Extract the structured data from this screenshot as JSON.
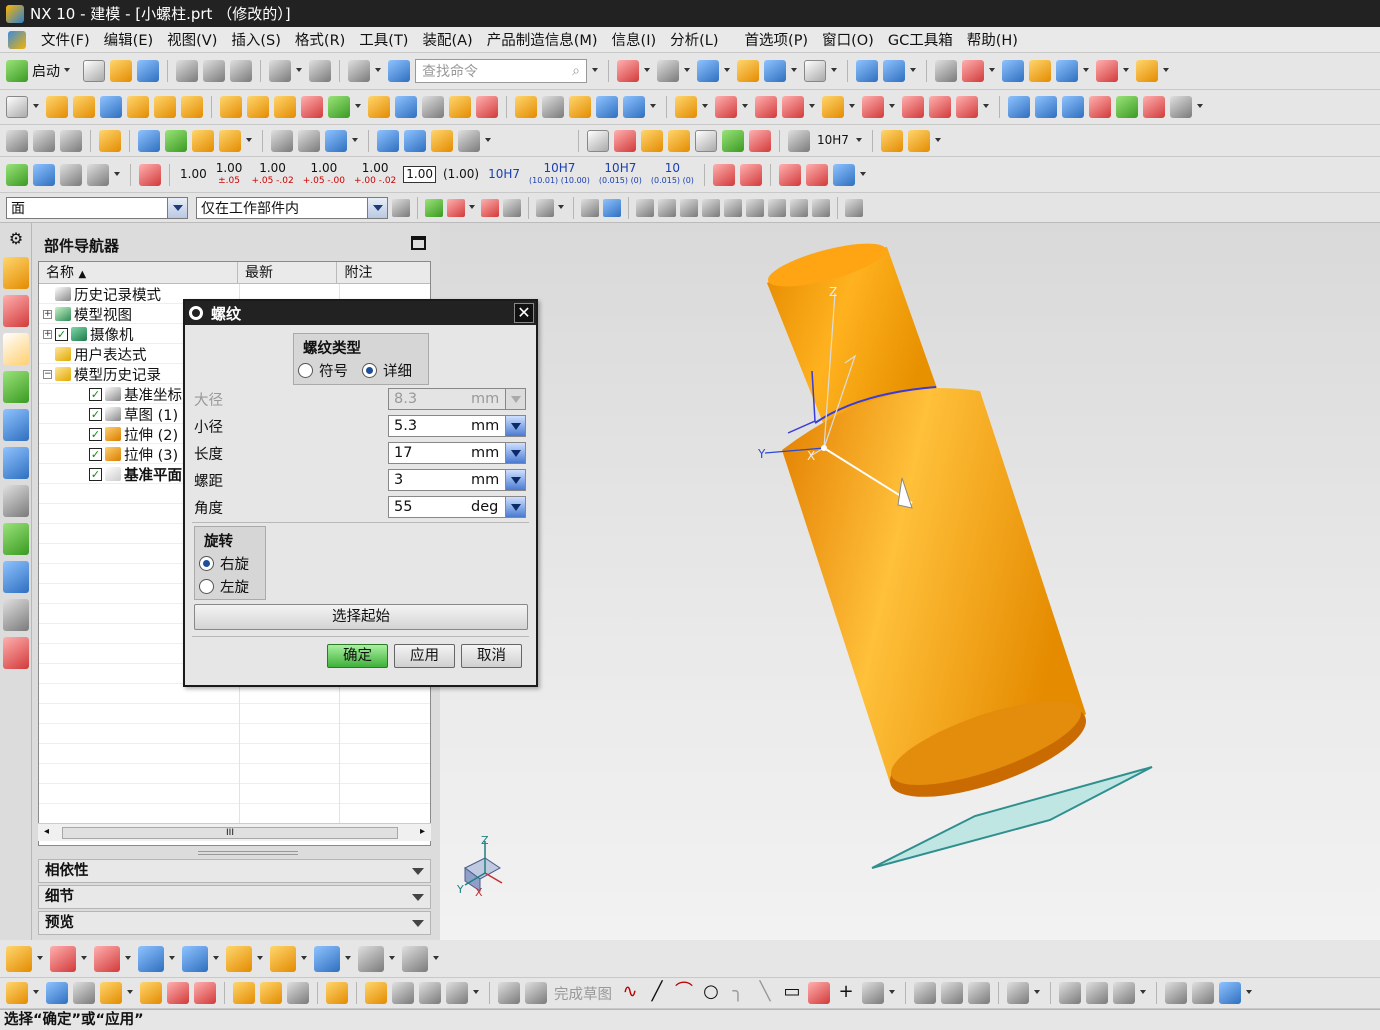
{
  "window": {
    "title": "NX 10 - 建模 - [小螺柱.prt （修改的）]"
  },
  "menu": [
    "文件(F)",
    "编辑(E)",
    "视图(V)",
    "插入(S)",
    "格式(R)",
    "工具(T)",
    "装配(A)",
    "产品制造信息(M)",
    "信息(I)",
    "分析(L)",
    "首选项(P)",
    "窗口(O)",
    "GC工具箱",
    "帮助(H)"
  ],
  "toolbar1": {
    "start_label": "启动",
    "search_placeholder": "查找命令"
  },
  "dim_toolbar": {
    "items": [
      {
        "main": "1.00",
        "sub": ""
      },
      {
        "main": "1.00",
        "sub": "±.05"
      },
      {
        "main": "1.00",
        "sub": "+.05 -.02"
      },
      {
        "main": "1.00",
        "sub": "+.05 -.00"
      },
      {
        "main": "1.00",
        "sub": "+.00 -.02"
      },
      {
        "main": "1.00",
        "sub": ""
      },
      {
        "main": "(1.00)",
        "sub": ""
      },
      {
        "main": "10H7",
        "sub": ""
      },
      {
        "main": "10H7",
        "sub": "(10.01) (10.00)"
      },
      {
        "main": "10H7",
        "sub": "(0.015) (0)"
      },
      {
        "main": "10",
        "sub": "(0.015) (0)"
      }
    ],
    "chart_item": "10H7"
  },
  "selection_bar": {
    "filter": "面",
    "scope": "仅在工作部件内"
  },
  "navigator": {
    "title": "部件导航器",
    "columns": [
      "名称",
      "最新",
      "附注"
    ],
    "rows": [
      {
        "label": "历史记录模式",
        "indent": 0,
        "expand": "",
        "check": false,
        "icon": "clock"
      },
      {
        "label": "模型视图",
        "indent": 0,
        "expand": "+",
        "check": false,
        "icon": "views"
      },
      {
        "label": "摄像机",
        "indent": 0,
        "expand": "+",
        "check": true,
        "icon": "camera"
      },
      {
        "label": "用户表达式",
        "indent": 0,
        "expand": "",
        "check": false,
        "icon": "folder"
      },
      {
        "label": "模型历史记录",
        "indent": 0,
        "expand": "-",
        "check": false,
        "icon": "folder-open"
      },
      {
        "label": "基准坐标系",
        "indent": 1,
        "expand": "",
        "check": true,
        "icon": "csys"
      },
      {
        "label": "草图 (1) \"S",
        "indent": 1,
        "expand": "",
        "check": true,
        "icon": "sketch"
      },
      {
        "label": "拉伸 (2)",
        "indent": 1,
        "expand": "",
        "check": true,
        "icon": "extrude"
      },
      {
        "label": "拉伸 (3)",
        "indent": 1,
        "expand": "",
        "check": true,
        "icon": "extrude"
      },
      {
        "label": "基准平面",
        "indent": 1,
        "expand": "",
        "check": true,
        "icon": "plane",
        "bold": true
      }
    ],
    "sections": [
      "相依性",
      "细节",
      "预览"
    ]
  },
  "dialog": {
    "title": "螺纹",
    "type_group": {
      "label": "螺纹类型",
      "options": [
        "符号",
        "详细"
      ],
      "selected": "详细"
    },
    "fields": [
      {
        "label": "大径",
        "value": "8.3",
        "unit": "mm",
        "disabled": true
      },
      {
        "label": "小径",
        "value": "5.3",
        "unit": "mm",
        "disabled": false
      },
      {
        "label": "长度",
        "value": "17",
        "unit": "mm",
        "disabled": false
      },
      {
        "label": "螺距",
        "value": "3",
        "unit": "mm",
        "disabled": false
      },
      {
        "label": "角度",
        "value": "55",
        "unit": "deg",
        "disabled": false
      }
    ],
    "rotation": {
      "label": "旋转",
      "options": [
        "右旋",
        "左旋"
      ],
      "selected": "右旋"
    },
    "select_start": "选择起始",
    "buttons": {
      "ok": "确定",
      "apply": "应用",
      "cancel": "取消"
    }
  },
  "graphics": {
    "axis_labels": {
      "z": "Z",
      "y": "Y",
      "x": "X"
    },
    "triad_labels": {
      "z": "Z",
      "y": "Y",
      "x": "X"
    },
    "colors": {
      "part": "#f0a020",
      "plane": "#3f9a9a",
      "edge": "#3b3bd6"
    }
  },
  "bottom_toolbar": {
    "finish_sketch": "完成草图"
  },
  "status": "选择“确定”或“应用”"
}
